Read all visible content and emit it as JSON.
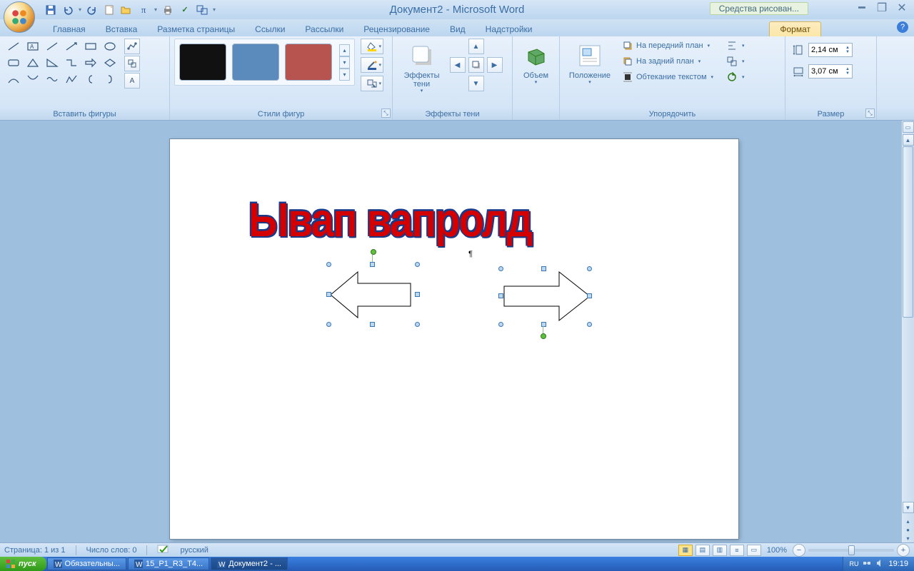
{
  "title": "Документ2 - Microsoft Word",
  "contextTabLabel": "Средства рисован...",
  "tabs": {
    "main": "Главная",
    "insert": "Вставка",
    "layout": "Разметка страницы",
    "refs": "Ссылки",
    "mail": "Рассылки",
    "review": "Рецензирование",
    "view": "Вид",
    "addins": "Надстройки",
    "format": "Формат"
  },
  "groups": {
    "shapes": "Вставить фигуры",
    "styles": "Стили фигур",
    "shadow": "Эффекты тени",
    "shadowBtn": "Эффекты тени",
    "volume": "Объем",
    "arrange": "Упорядочить",
    "position": "Положение",
    "size": "Размер"
  },
  "arrange": {
    "front": "На передний план",
    "back": "На задний план",
    "wrap": "Обтекание текстом"
  },
  "size": {
    "height": "2,14 см",
    "width": "3,07 см"
  },
  "wordart": "Ывап вапролд",
  "status": {
    "page": "Страница: 1 из 1",
    "words": "Число слов: 0",
    "lang": "русский",
    "zoom": "100%"
  },
  "taskbar": {
    "start": "пуск",
    "t1": "Обязательны...",
    "t2": "15_P1_R3_T4...",
    "t3": "Документ2 - ...",
    "lang": "RU",
    "time": "19:19"
  }
}
